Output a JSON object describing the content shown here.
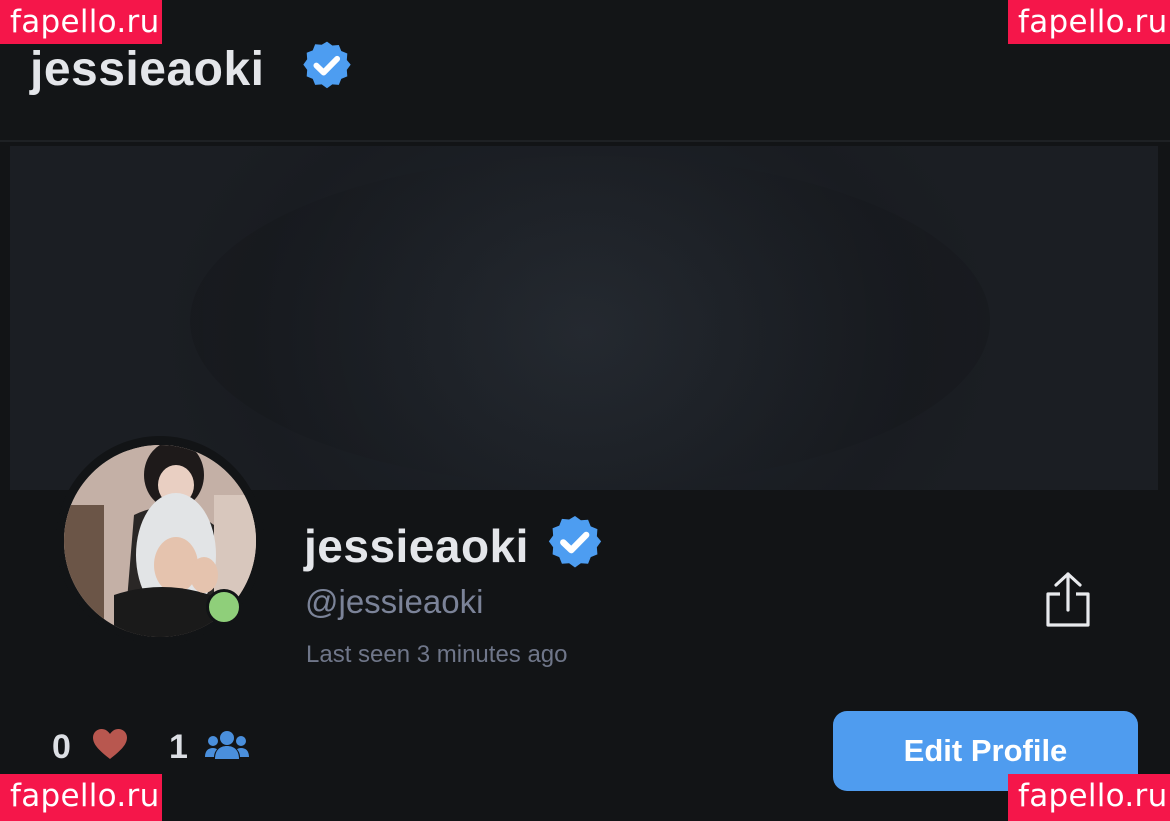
{
  "header": {
    "title": "jessieaoki"
  },
  "profile": {
    "name": "jessieaoki",
    "handle": "@jessieaoki",
    "last_seen": "Last seen 3 minutes ago",
    "online": true
  },
  "stats": {
    "likes": "0",
    "fans": "1"
  },
  "actions": {
    "edit_profile_label": "Edit Profile"
  },
  "icons": {
    "verified": "verified-badge-icon",
    "share": "share-icon",
    "likes": "heart-icon",
    "fans": "users-icon"
  },
  "colors": {
    "accent": "#4f9cef",
    "verified": "#4d9df1",
    "online": "#8fcf7a",
    "heart": "#b8574f",
    "watermark": "#f5164a"
  },
  "watermarks": [
    "fapello.ru",
    "fapello.ru",
    "fapello.ru",
    "fapello.ru"
  ]
}
